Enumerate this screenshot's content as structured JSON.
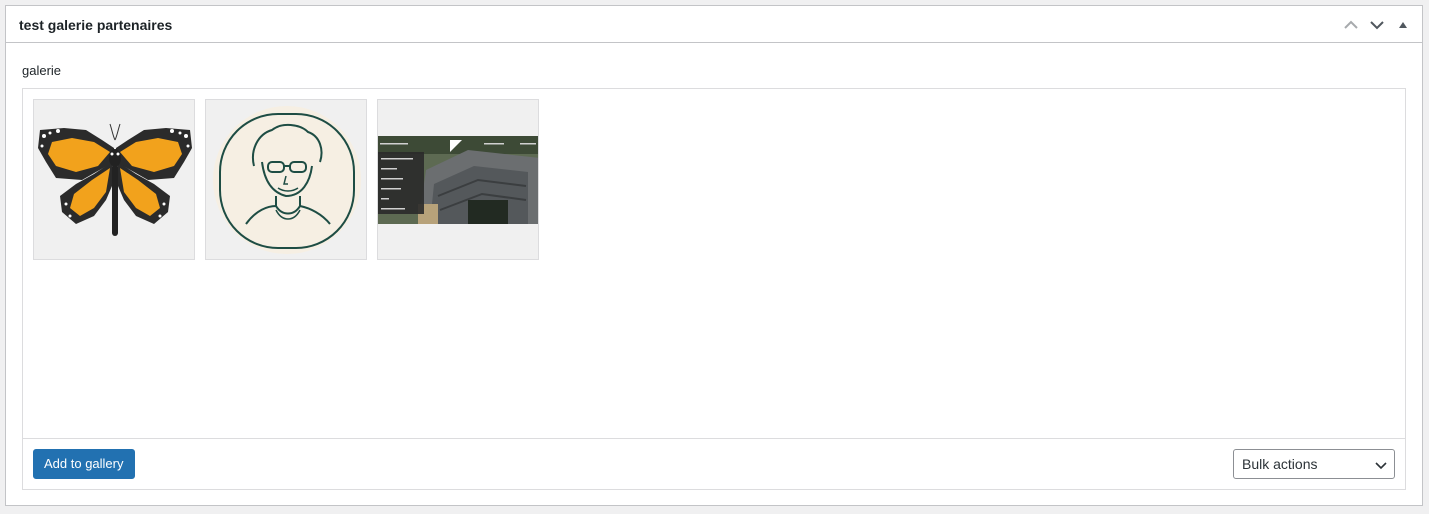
{
  "metabox": {
    "title": "test galerie partenaires",
    "controls": [
      {
        "icon": "chevron-up-icon",
        "label": "Move up"
      },
      {
        "icon": "chevron-down-icon",
        "label": "Move down"
      },
      {
        "icon": "toggle-panel-icon",
        "label": "Toggle panel"
      }
    ]
  },
  "field": {
    "label": "galerie"
  },
  "gallery": {
    "items": [
      {
        "type": "image",
        "icon": "butterfly-image"
      },
      {
        "type": "image",
        "icon": "portrait-illustration-image"
      },
      {
        "type": "image",
        "icon": "website-screenshot-image"
      }
    ]
  },
  "toolbar": {
    "add_label": "Add to gallery",
    "bulk_selected": "Bulk actions"
  },
  "colors": {
    "primary_button": "#2271b1",
    "border": "#c3c4c7",
    "background": "#f0f0f1"
  }
}
